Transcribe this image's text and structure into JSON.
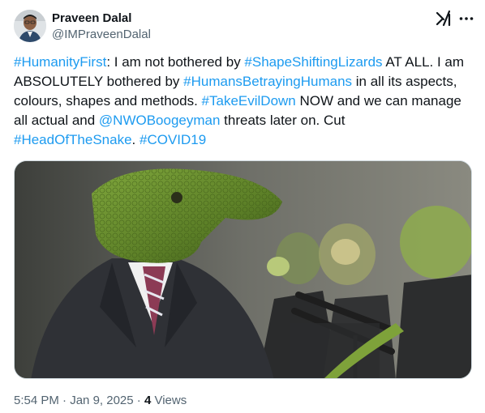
{
  "author": {
    "name": "Praveen Dalal",
    "handle": "@IMPraveenDalal"
  },
  "icons": {
    "grok": "grok-icon",
    "more": "more-options-icon"
  },
  "tweet": {
    "segments": [
      {
        "text": "#HumanityFirst",
        "link": true
      },
      {
        "text": ": I am not bothered by ",
        "link": false
      },
      {
        "text": "#ShapeShiftingLizards",
        "link": true
      },
      {
        "text": " AT ALL. I am ABSOLUTELY bothered by ",
        "link": false
      },
      {
        "text": "#HumansBetrayingHumans",
        "link": true
      },
      {
        "text": " in all its aspects, colours, shapes and methods. ",
        "link": false
      },
      {
        "text": "#TakeEvilDown",
        "link": true
      },
      {
        "text": " NOW and we can manage all actual and ",
        "link": false
      },
      {
        "text": "@NWOBoogeyman",
        "link": true
      },
      {
        "text": " threats later on. Cut ",
        "link": false
      },
      {
        "text": "#HeadOfTheSnake",
        "link": true
      },
      {
        "text": ". ",
        "link": false
      },
      {
        "text": "#COVID19",
        "link": true
      }
    ]
  },
  "meta": {
    "time": "5:54 PM",
    "separator": " · ",
    "date": "Jan 9, 2025",
    "views_count": "4",
    "views_label": " Views"
  },
  "colors": {
    "link": "#1d9bf0",
    "text": "#0f1419",
    "secondary": "#536471",
    "border": "#cfd9de"
  }
}
